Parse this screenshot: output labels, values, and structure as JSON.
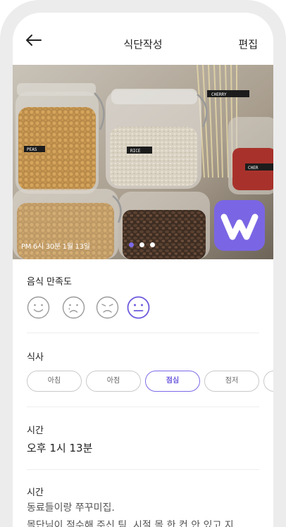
{
  "header": {
    "title": "식단작성",
    "edit_label": "편집"
  },
  "photo": {
    "timestamp": "PM 6시 30분 1월 13일",
    "pager": {
      "count": 3,
      "active": 1
    },
    "jar_labels": [
      "PEAS",
      "RICE",
      "CHERRY",
      "CHER"
    ]
  },
  "satisfaction": {
    "label": "음식 만족도",
    "faces": [
      "smile",
      "sad-tear",
      "frown",
      "neutral"
    ],
    "selected": "neutral"
  },
  "meal": {
    "label": "식사",
    "options": [
      "아침",
      "아점",
      "점심",
      "점저"
    ],
    "selected": "점심"
  },
  "time": {
    "label": "시간",
    "value": "오후 1시 13분"
  },
  "memo": {
    "label": "시간",
    "lines": [
      "동료들이랑 쭈꾸미집.",
      "몰단님이 적수해 주신 팀. 시절 몰 한 컨 안 있고 지"
    ]
  },
  "colors": {
    "accent": "#7b6ae6",
    "logo": "#7a66e4"
  }
}
